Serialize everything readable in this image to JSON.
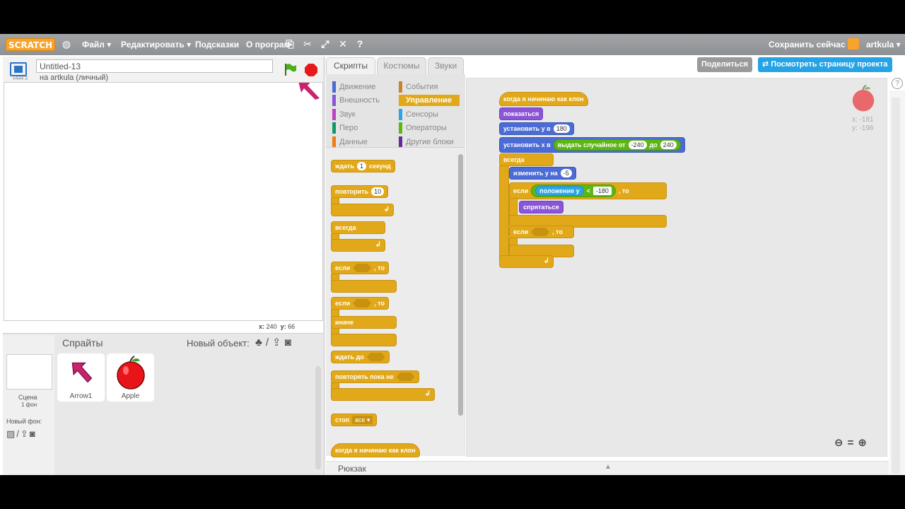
{
  "menubar": {
    "logo": "SCRATCH",
    "file": "Файл ▾",
    "edit": "Редактировать ▾",
    "tips": "Подсказки",
    "about": "О програм",
    "save_now": "Сохранить сейчас",
    "username": "artkula ▾"
  },
  "stage": {
    "version": "v444.3",
    "title": "Untitled-13",
    "author": "на artkula (личный)",
    "x_label": "x:",
    "x_value": "240",
    "y_label": "y:",
    "y_value": "66"
  },
  "sprites": {
    "title": "Спрайты",
    "new_object": "Новый объект:",
    "scene_label": "Сцена",
    "scene_sub": "1 фон",
    "new_backdrop": "Новый фон:",
    "items": [
      {
        "name": "Arrow1"
      },
      {
        "name": "Apple"
      }
    ]
  },
  "tabs": [
    "Скрипты",
    "Костюмы",
    "Звуки"
  ],
  "actions": {
    "share": "Поделиться",
    "view_page": "Посмотреть страницу проекта"
  },
  "categories": [
    {
      "label": "Движение",
      "color": "#4a6cd4"
    },
    {
      "label": "События",
      "color": "#c88330"
    },
    {
      "label": "Внешность",
      "color": "#8a55d7"
    },
    {
      "label": "Управление",
      "color": "#e1a91a"
    },
    {
      "label": "Звук",
      "color": "#bb42c3"
    },
    {
      "label": "Сенсоры",
      "color": "#2ca5e2"
    },
    {
      "label": "Перо",
      "color": "#0e9a6c"
    },
    {
      "label": "Операторы",
      "color": "#5cb712"
    },
    {
      "label": "Данные",
      "color": "#ee7d16"
    },
    {
      "label": "Другие блоки",
      "color": "#632d99"
    }
  ],
  "palette": {
    "wait": "ждать",
    "wait_num": "1",
    "wait_unit": "секунд",
    "repeat": "повторить",
    "repeat_num": "10",
    "forever": "всегда",
    "if": "если",
    "then": ", то",
    "else": "иначе",
    "wait_until": "ждать до",
    "repeat_until": "повторять пока не",
    "stop": "стоп",
    "stop_opt": "все ▾",
    "clone_hat": "когда я начинаю как клон"
  },
  "script": {
    "hat": "когда я начинаю как клон",
    "show": "показаться",
    "set_y": "установить y в",
    "set_y_val": "180",
    "set_x": "установить x в",
    "random": "выдать случайное от",
    "rand_from": "-240",
    "rand_to_label": "до",
    "rand_to": "240",
    "forever": "всегда",
    "change_y": "изменить y на",
    "change_y_val": "-5",
    "if1": "если",
    "y_pos": "положение y",
    "lt": "<",
    "lt_val": "-180",
    "then": ", то",
    "hide": "спрятаться",
    "if2": "если",
    "then2": ", то"
  },
  "sprite_info": {
    "x": "x: -181",
    "y": "y: -196"
  },
  "backpack": "Рюкзак"
}
